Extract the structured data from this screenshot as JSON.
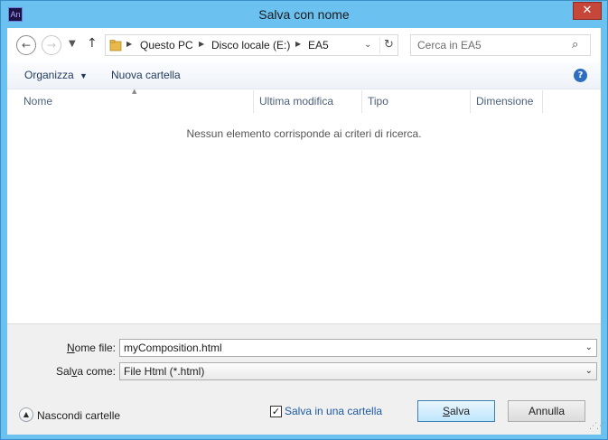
{
  "window": {
    "title": "Salva con nome",
    "app_icon_text": "An",
    "close_glyph": "✕"
  },
  "nav": {
    "back_icon": "arrow-left-icon",
    "forward_icon": "arrow-right-icon",
    "recent_icon": "chevron-down-icon",
    "up_icon": "arrow-up-icon"
  },
  "address": {
    "crumbs": [
      "Questo PC",
      "Disco locale (E:)",
      "EA5"
    ]
  },
  "search": {
    "placeholder": "Cerca in EA5"
  },
  "toolbar": {
    "organize_label": "Organizza",
    "new_folder_label": "Nuova cartella"
  },
  "columns": [
    "Nome",
    "Ultima modifica",
    "Tipo",
    "Dimensione"
  ],
  "file_list": {
    "empty_message": "Nessun elemento corrisponde ai criteri di ricerca."
  },
  "form": {
    "filename_label_u": "N",
    "filename_label_rest": "ome file:",
    "filename_value": "myComposition.html",
    "savetype_label_pre": "Sal",
    "savetype_label_u": "v",
    "savetype_label_rest": "a come:",
    "savetype_value": "File Html (*.html)"
  },
  "footer": {
    "hide_folders_label": "Nascondi cartelle",
    "save_in_folder_label": "Salva in una cartella",
    "save_in_folder_checked": true,
    "save_button_u": "S",
    "save_button_rest": "alva",
    "cancel_button": "Annulla"
  }
}
